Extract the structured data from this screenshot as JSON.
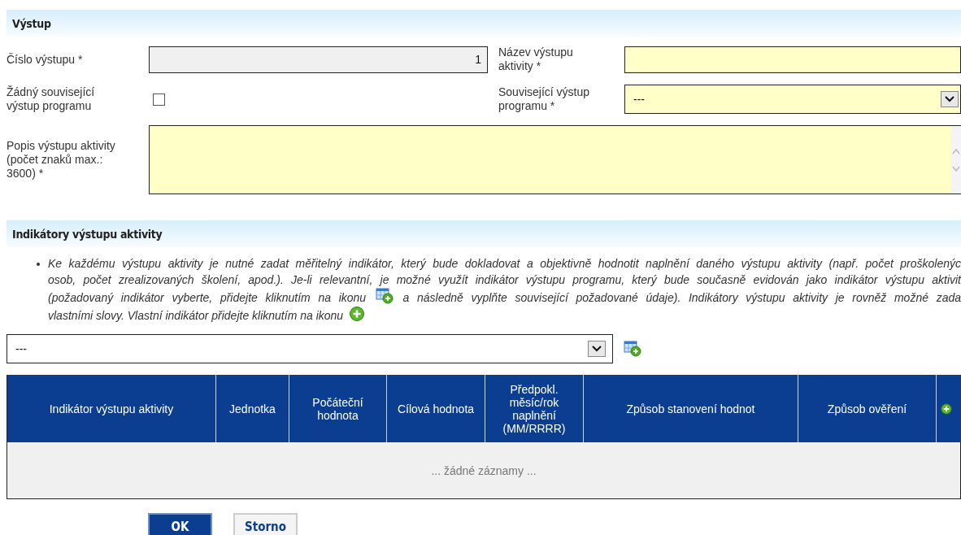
{
  "output": {
    "title": "Výstup",
    "number": {
      "label": "Číslo výstupu *",
      "value": "1",
      "disabled": true
    },
    "name": {
      "label": "Název výstupu aktivity *"
    },
    "no_related": {
      "label": "Žádný související výstup programu",
      "checked": false
    },
    "related": {
      "label": "Související výstup programu *",
      "value": "---"
    },
    "description": {
      "label": "Popis výstupu aktivity (počet znaků max.: 3600) *"
    }
  },
  "indicators": {
    "title": "Indikátory výstupu aktivity",
    "instructions": [
      {
        "segments": [
          "Ke každému výstupu aktivity je nutné zadat měřitelný indikátor, který bude dokladovat a objektivně hodnotit naplnění daného výstupu aktivity (např. počet proškolenýc"
        ]
      },
      {
        "segments": [
          "osob, počet zrealizovaných školení, apod.). Je-li relevantní, je možné využít indikátor výstupu programu, který bude současně evidován jako indikátor výstupu aktivit"
        ]
      },
      {
        "segments": [
          "(požadovaný indikátor vyberte, přidejte kliknutím na ikonu",
          "a následně vyplňte související požadované údaje). Indikátory výstupu aktivity je rovněž možné zada"
        ]
      },
      {
        "segments": [
          "vlastními slovy. Vlastní indikátor přidejte kliknutím na ikonu"
        ],
        "ends_with_icon": true
      }
    ],
    "select": {
      "value": "---"
    },
    "table": {
      "columns": [
        "Indikátor výstupu aktivity",
        "Jednotka",
        "Počáteční hodnota",
        "Cílová hodnota",
        "Předpokl. měsíc/rok naplnění (MM/RRRR)",
        "Způsob stanovení hodnot",
        "Způsob ověření"
      ],
      "empty_text": "... žádné záznamy ..."
    }
  },
  "buttons": [
    {
      "label": "OK",
      "kind": "primary"
    },
    {
      "label": "Storno",
      "kind": "secondary"
    }
  ]
}
